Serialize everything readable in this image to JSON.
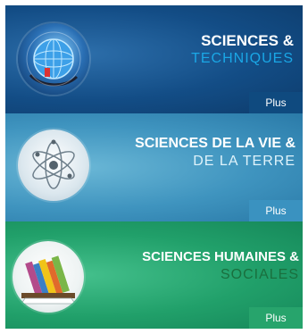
{
  "cards": [
    {
      "title_line1": "SCIENCES &",
      "title_line2": "TECHNIQUES",
      "button_label": "Plus",
      "icon": "globe-network-icon",
      "colors": {
        "background": "#134d86",
        "accent": "#1aa7e6",
        "button": "#0f4a7f"
      }
    },
    {
      "title_line1": "SCIENCES DE LA VIE &",
      "title_line2": "DE LA TERRE",
      "button_label": "Plus",
      "icon": "atom-icon",
      "colors": {
        "background": "#3f94bf",
        "accent": "#dff3fb",
        "button": "#3a92c0"
      }
    },
    {
      "title_line1": "SCIENCES HUMAINES &",
      "title_line2": "SOCIALES",
      "button_label": "Plus",
      "icon": "books-icon",
      "colors": {
        "background": "#21a06a",
        "accent": "#1a6f3e",
        "button": "#27a46c"
      }
    }
  ]
}
